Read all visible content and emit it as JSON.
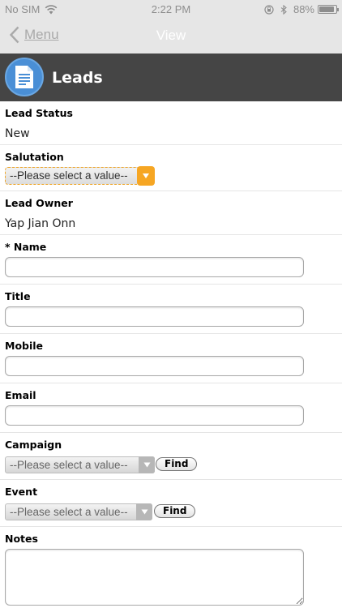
{
  "status_bar": {
    "carrier": "No SIM",
    "time": "2:22 PM",
    "battery_percent": "88%",
    "battery_level": 0.88
  },
  "nav": {
    "back_label": "Menu",
    "title": "View"
  },
  "header": {
    "title": "Leads",
    "icon": "document-icon",
    "icon_color": "#4a8fd6"
  },
  "form": {
    "lead_status": {
      "label": "Lead Status",
      "value": "New"
    },
    "salutation": {
      "label": "Salutation",
      "selected": "--Please select a value--"
    },
    "lead_owner": {
      "label": "Lead Owner",
      "value": "Yap Jian Onn"
    },
    "name": {
      "label": "* Name",
      "value": ""
    },
    "title": {
      "label": "Title",
      "value": ""
    },
    "mobile": {
      "label": "Mobile",
      "value": ""
    },
    "email": {
      "label": "Email",
      "value": ""
    },
    "campaign": {
      "label": "Campaign",
      "selected": "--Please select a value--",
      "find_label": "Find"
    },
    "event": {
      "label": "Event",
      "selected": "--Please select a value--",
      "find_label": "Find"
    },
    "notes": {
      "label": "Notes",
      "value": ""
    }
  },
  "colors": {
    "header_bg": "#454545",
    "nav_bg": "#e6e6e6",
    "accent_orange": "#f6a623"
  }
}
